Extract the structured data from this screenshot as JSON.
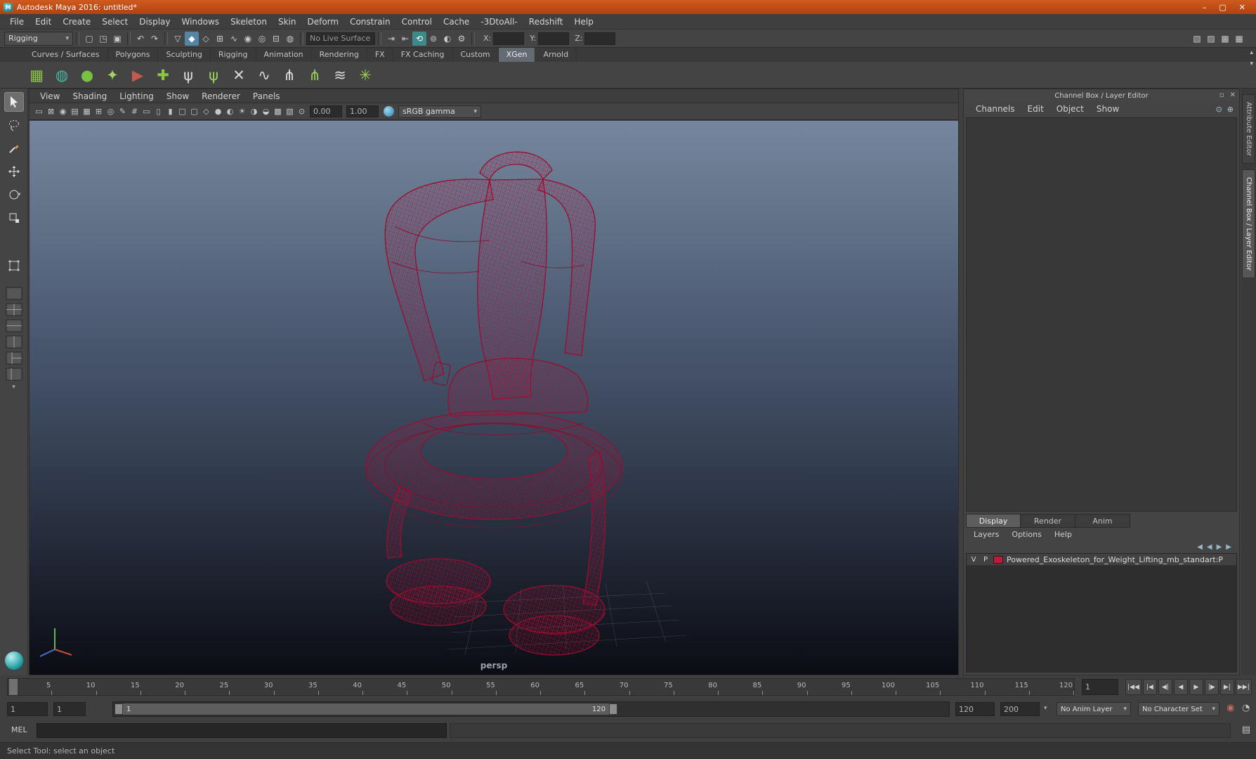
{
  "ui": {
    "dropdown_arrow": "▾",
    "scroll_up": "▴",
    "scroll_down": "▾",
    "dock_icon": "▫",
    "close_icon": "✕",
    "logo_letter": "M",
    "script_editor_icon": "▤",
    "layout_caret": "▾"
  },
  "window": {
    "title": "Autodesk Maya 2016: untitled*",
    "minimize": "–",
    "maximize": "▢",
    "close": "✕"
  },
  "menu_bar": {
    "items": [
      "File",
      "Edit",
      "Create",
      "Select",
      "Display",
      "Windows",
      "Skeleton",
      "Skin",
      "Deform",
      "Constrain",
      "Control",
      "Cache",
      "-3DtoAll-",
      "Redshift",
      "Help"
    ]
  },
  "status_line": {
    "menu_set": "Rigging",
    "file_icons": [
      {
        "n": "new-scene-icon",
        "g": "▢"
      },
      {
        "n": "open-scene-icon",
        "g": "◳"
      },
      {
        "n": "save-scene-icon",
        "g": "▣"
      }
    ],
    "history_icons": [
      {
        "n": "undo-icon",
        "g": "↶"
      },
      {
        "n": "redo-icon",
        "g": "↷"
      }
    ],
    "selection_mask_icons": [
      {
        "n": "select-hierarchy-icon",
        "g": "▽"
      },
      {
        "n": "select-object-icon",
        "g": "◆",
        "cls": "hl"
      },
      {
        "n": "select-component-icon",
        "g": "◇"
      }
    ],
    "snap_icons": [
      {
        "n": "snap-to-grid-icon",
        "g": "⊞"
      },
      {
        "n": "snap-to-curves-icon",
        "g": "∿"
      },
      {
        "n": "snap-to-points-icon",
        "g": "◉"
      },
      {
        "n": "snap-to-projected-center-icon",
        "g": "◎"
      },
      {
        "n": "snap-to-view-planes-icon",
        "g": "⊟"
      },
      {
        "n": "make-live-icon",
        "g": "◍"
      }
    ],
    "live_surface": "No Live Surface",
    "construction_icons": [
      {
        "n": "input-connections-icon",
        "g": "⇥"
      },
      {
        "n": "output-connections-icon",
        "g": "⇤"
      },
      {
        "n": "construction-history-icon",
        "g": "⟲",
        "cls": "hl-teal"
      },
      {
        "n": "render-icon",
        "g": "⊚"
      },
      {
        "n": "ipr-render-icon",
        "g": "◐"
      },
      {
        "n": "render-settings-icon",
        "g": "⚙"
      }
    ],
    "coord_labels": {
      "x": "X:",
      "y": "Y:",
      "z": "Z:"
    },
    "right_icons": [
      {
        "n": "toggle-modeling-toolkit-icon",
        "g": "▧"
      },
      {
        "n": "toggle-attribute-editor-icon",
        "g": "▨"
      },
      {
        "n": "toggle-tool-settings-icon",
        "g": "▩"
      },
      {
        "n": "toggle-channel-box-icon",
        "g": "▦"
      }
    ]
  },
  "shelf": {
    "tabs": [
      "Curves / Surfaces",
      "Polygons",
      "Sculpting",
      "Rigging",
      "Animation",
      "Rendering",
      "FX",
      "FX Caching",
      "Custom",
      "XGen",
      "Arnold"
    ],
    "active_tab": "XGen",
    "menu_icon": "▤",
    "gear_icon": "⚙",
    "icons": [
      {
        "n": "xgen-editor-icon",
        "g": "▦",
        "c": "#8dc63f"
      },
      {
        "n": "xgen-export-selection-icon",
        "g": "◍",
        "c": "#49b8a8"
      },
      {
        "n": "xgen-create-description-icon",
        "g": "●",
        "c": "#79c143"
      },
      {
        "n": "xgen-add-collection-icon",
        "g": "✦",
        "c": "#a3d55d"
      },
      {
        "n": "xgen-update-preview-icon",
        "g": "▶",
        "c": "#c25b4e"
      },
      {
        "n": "xgen-clear-preview-icon",
        "g": "✚",
        "c": "#8dc63f"
      },
      {
        "n": "xgen-comb-brush-icon",
        "g": "ψ",
        "c": "#d8d8d8"
      },
      {
        "n": "xgen-length-brush-icon",
        "g": "ψ",
        "c": "#9bd05a"
      },
      {
        "n": "xgen-cut-brush-icon",
        "g": "✕",
        "c": "#d8d8d8"
      },
      {
        "n": "xgen-noise-brush-icon",
        "g": "∿",
        "c": "#d8d8d8"
      },
      {
        "n": "xgen-place-guides-icon",
        "g": "⋔",
        "c": "#e0e0e0"
      },
      {
        "n": "xgen-sculpt-guides-icon",
        "g": "⋔",
        "c": "#9bd05a"
      },
      {
        "n": "xgen-guides-to-curves-icon",
        "g": "≋",
        "c": "#d8d8d8"
      },
      {
        "n": "xgen-interactive-groom-icon",
        "g": "✳",
        "c": "#9bd05a"
      }
    ]
  },
  "viewport": {
    "menu": [
      "View",
      "Shading",
      "Lighting",
      "Show",
      "Renderer",
      "Panels"
    ],
    "toolbar_icons": [
      {
        "n": "select-camera-icon",
        "g": "▭"
      },
      {
        "n": "lock-camera-icon",
        "g": "⊠"
      },
      {
        "n": "camera-attributes-icon",
        "g": "◉"
      },
      {
        "n": "bookmarks-icon",
        "g": "▤"
      },
      {
        "n": "image-plane-icon",
        "g": "▦"
      },
      {
        "n": "2d-pan-zoom-icon",
        "g": "⊞"
      },
      {
        "n": "oversampling-icon",
        "g": "◎"
      },
      {
        "n": "grease-pencil-icon",
        "g": "✎"
      },
      {
        "n": "grid-icon",
        "g": "#"
      },
      {
        "n": "film-gate-icon",
        "g": "▭"
      },
      {
        "n": "resolution-gate-icon",
        "g": "▯"
      },
      {
        "n": "gate-mask-icon",
        "g": "▮"
      },
      {
        "n": "safe-action-icon",
        "g": "□"
      },
      {
        "n": "safe-title-icon",
        "g": "▢"
      },
      {
        "n": "wireframe-mode-icon",
        "g": "◇"
      },
      {
        "n": "shaded-mode-icon",
        "g": "●"
      },
      {
        "n": "textured-mode-icon",
        "g": "◐"
      },
      {
        "n": "use-all-lights-icon",
        "g": "☀"
      },
      {
        "n": "shadows-icon",
        "g": "◑"
      },
      {
        "n": "ambient-occlusion-icon",
        "g": "◒"
      },
      {
        "n": "anti-alias-icon",
        "g": "▩"
      },
      {
        "n": "xray-icon",
        "g": "▧"
      },
      {
        "n": "isolate-select-icon",
        "g": "⊙"
      }
    ],
    "exposure_value": "0.00",
    "gamma_value": "1.00",
    "color_transform": "sRGB gamma",
    "camera_label": "persp"
  },
  "channel_box": {
    "title": "Channel Box / Layer Editor",
    "menu": [
      "Channels",
      "Edit",
      "Object",
      "Show"
    ],
    "corner_icons": [
      {
        "n": "speed-graph-icon",
        "g": "⊙"
      },
      {
        "n": "hyperbolic-spread-icon",
        "g": "⊕"
      }
    ],
    "layer_tabs": [
      "Display",
      "Render",
      "Anim"
    ],
    "layer_menu": [
      "Layers",
      "Options",
      "Help"
    ],
    "layer_toolbar_icons": [
      {
        "n": "layer-move-up-icon",
        "g": "◀"
      },
      {
        "n": "layer-move-down-icon",
        "g": "◀"
      },
      {
        "n": "new-empty-layer-icon",
        "g": "▶"
      },
      {
        "n": "new-layer-from-selected-icon",
        "g": "▶"
      }
    ],
    "layers": [
      {
        "visible": "V",
        "playback": "P",
        "swatch": "#c01839",
        "name": "Powered_Exoskeleton_for_Weight_Lifting_mb_standart:P"
      }
    ]
  },
  "side_tabs": {
    "attribute_editor": "Attribute Editor",
    "channel_box": "Channel Box / Layer Editor"
  },
  "timeline": {
    "ticks": [
      "5",
      "10",
      "15",
      "20",
      "25",
      "30",
      "35",
      "40",
      "45",
      "50",
      "55",
      "60",
      "65",
      "70",
      "75",
      "80",
      "85",
      "90",
      "95",
      "100",
      "105",
      "110",
      "115",
      "120"
    ],
    "current_frame": "1"
  },
  "playback": {
    "buttons": [
      {
        "n": "go-to-start-button",
        "g": "|◀◀"
      },
      {
        "n": "step-back-key-button",
        "g": "|◀"
      },
      {
        "n": "step-back-frame-button",
        "g": "◀|"
      },
      {
        "n": "play-backwards-button",
        "g": "◀"
      },
      {
        "n": "play-forwards-button",
        "g": "▶"
      },
      {
        "n": "step-forward-frame-button",
        "g": "|▶"
      },
      {
        "n": "step-forward-key-button",
        "g": "▶|"
      },
      {
        "n": "go-to-end-button",
        "g": "▶▶|"
      }
    ]
  },
  "range_slider": {
    "playback_start": "1",
    "animation_start": "1",
    "range_label_start": "1",
    "range_label_end": "120",
    "playback_end": "120",
    "animation_end": "200",
    "anim_layer": "No Anim Layer",
    "character_set": "No Character Set",
    "autokey_icon": "◉",
    "prefs_icon": "◔"
  },
  "command_line": {
    "label": "MEL"
  },
  "help_line": {
    "text": "Select Tool: select an object"
  }
}
